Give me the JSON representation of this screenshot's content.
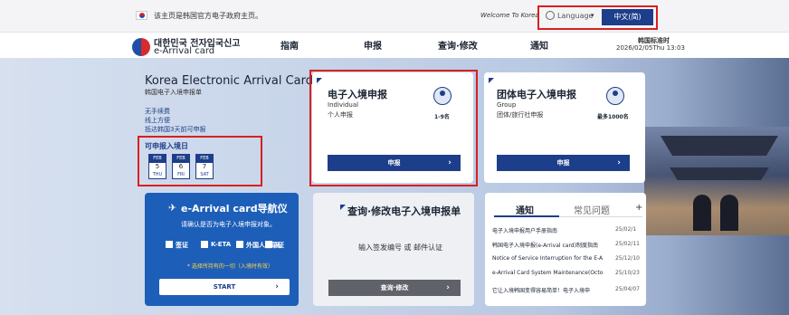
{
  "topbar": {
    "gov_note": "该主页是韩国官方电子政府主页。",
    "welcome": "Welcome To Korea",
    "language_label": "Language",
    "language_caret": "▾",
    "language_button": "中文(简)"
  },
  "header": {
    "logo_korean": "대한민국 전자입국신고",
    "logo_english": "e-Arrival card",
    "nav": [
      "指南",
      "申报",
      "查询·修改",
      "通知"
    ],
    "kst_label": "韩国标准时",
    "kst_time": "2026/02/05Thu 13:03"
  },
  "hero": {
    "title": "Korea Electronic Arrival Card",
    "subtitle": "韩国电子入境申报单",
    "lines": [
      "无手续费",
      "线上方便",
      "抵达韩国3天前可申报"
    ],
    "available_label": "可申报入境日",
    "dates": [
      {
        "month": "FEB",
        "day": "5",
        "weekday": "THU"
      },
      {
        "month": "FEB",
        "day": "6",
        "weekday": "FRI"
      },
      {
        "month": "FEB",
        "day": "7",
        "weekday": "SAT"
      }
    ]
  },
  "individual_card": {
    "title": "电子入境申报",
    "english": "Individual",
    "chinese": "个人申报",
    "count": "1-9名",
    "button": "申报",
    "chevron": "›"
  },
  "group_card": {
    "title": "团体电子入境申报",
    "english": "Group",
    "chinese": "团体/旅行社申报",
    "count": "最多1000名",
    "button": "申报",
    "chevron": "›"
  },
  "navigator": {
    "title": "e-Arrival card导航仪",
    "plane": "✈",
    "question": "请确认是否为电子入境申报对象。",
    "options": [
      "签证",
      "K-ETA",
      "外国人登录证",
      "无"
    ],
    "note": "* 选择所持有的一切（入境时有效）",
    "start": "START",
    "chevron": "›"
  },
  "inquiry": {
    "title": "查询·修改电子入境申报单",
    "text": "输入签发编号 或 邮件认证",
    "button": "查询·修改",
    "chevron": "›"
  },
  "notices": {
    "tab_active": "通知",
    "tab_inactive": "常见问题",
    "plus": "+",
    "items": [
      {
        "title": "电子入境申报用户手册指南",
        "date": "25/02/1"
      },
      {
        "title": "韩国电子入境申报(e-Arrival card)制度指南",
        "date": "25/02/11"
      },
      {
        "title": "Notice of Service Interruption for the E-A",
        "date": "25/12/10"
      },
      {
        "title": "e-Arrival Card System Maintenance(Octo",
        "date": "25/10/23"
      },
      {
        "title": "它让入境韩国变得容易简单！电子入境申",
        "date": "25/04/07"
      }
    ]
  }
}
